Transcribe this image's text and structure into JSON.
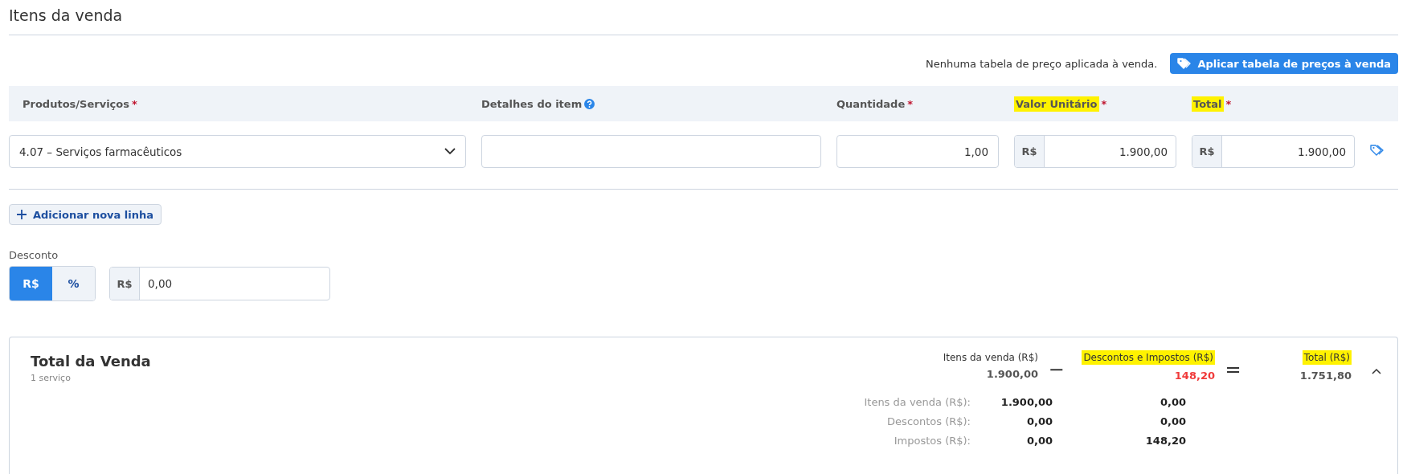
{
  "section_title": "Itens da venda",
  "price_table": {
    "note": "Nenhuma tabela de preço aplicada à venda.",
    "button": "Aplicar tabela de preços à venda"
  },
  "columns": [
    {
      "label": "Produtos/Serviços",
      "required_mark": "*",
      "highlighted": false
    },
    {
      "label": "Detalhes do item",
      "highlighted": false,
      "help": true
    },
    {
      "label": "Quantidade",
      "required_mark": "*",
      "highlighted": false
    },
    {
      "label": "Valor Unitário",
      "required_mark": "*",
      "highlighted": true
    },
    {
      "label": "Total",
      "required_mark": "*",
      "highlighted": true
    }
  ],
  "rows": [
    {
      "product": "4.07 – Serviços farmacêuticos",
      "quantity": "1,00",
      "unit_currency": "R$",
      "unit_value": "1.900,00",
      "total_currency": "R$",
      "total": "1.900,00"
    }
  ],
  "add_line_button": "Adicionar nova linha",
  "discount": {
    "label": "Desconto",
    "modes": [
      {
        "label": "R$",
        "selected": true
      },
      {
        "label": "%",
        "selected": false
      }
    ],
    "currency": "R$",
    "value": "0,00"
  },
  "summary": {
    "title": "Total da Venda",
    "subtitle": "1 serviço",
    "expanded": true,
    "terms": [
      {
        "label": "Itens da venda (R$)",
        "value": "1.900,00",
        "highlighted": false,
        "negative": false
      },
      {
        "label": "Descontos e Impostos (R$)",
        "value": "148,20",
        "highlighted": true,
        "negative": true
      },
      {
        "label": "Total (R$)",
        "value": "1.751,80",
        "highlighted": true,
        "negative": false
      }
    ],
    "operators": [
      "−",
      "="
    ],
    "breakdown": [
      {
        "label": "Itens da venda (R$):",
        "values": [
          "1.900,00",
          "0,00"
        ]
      },
      {
        "label": "Descontos (R$):",
        "values": [
          "0,00",
          "0,00"
        ]
      },
      {
        "label": "Impostos (R$):",
        "values": [
          "0,00",
          "148,20"
        ]
      }
    ]
  }
}
